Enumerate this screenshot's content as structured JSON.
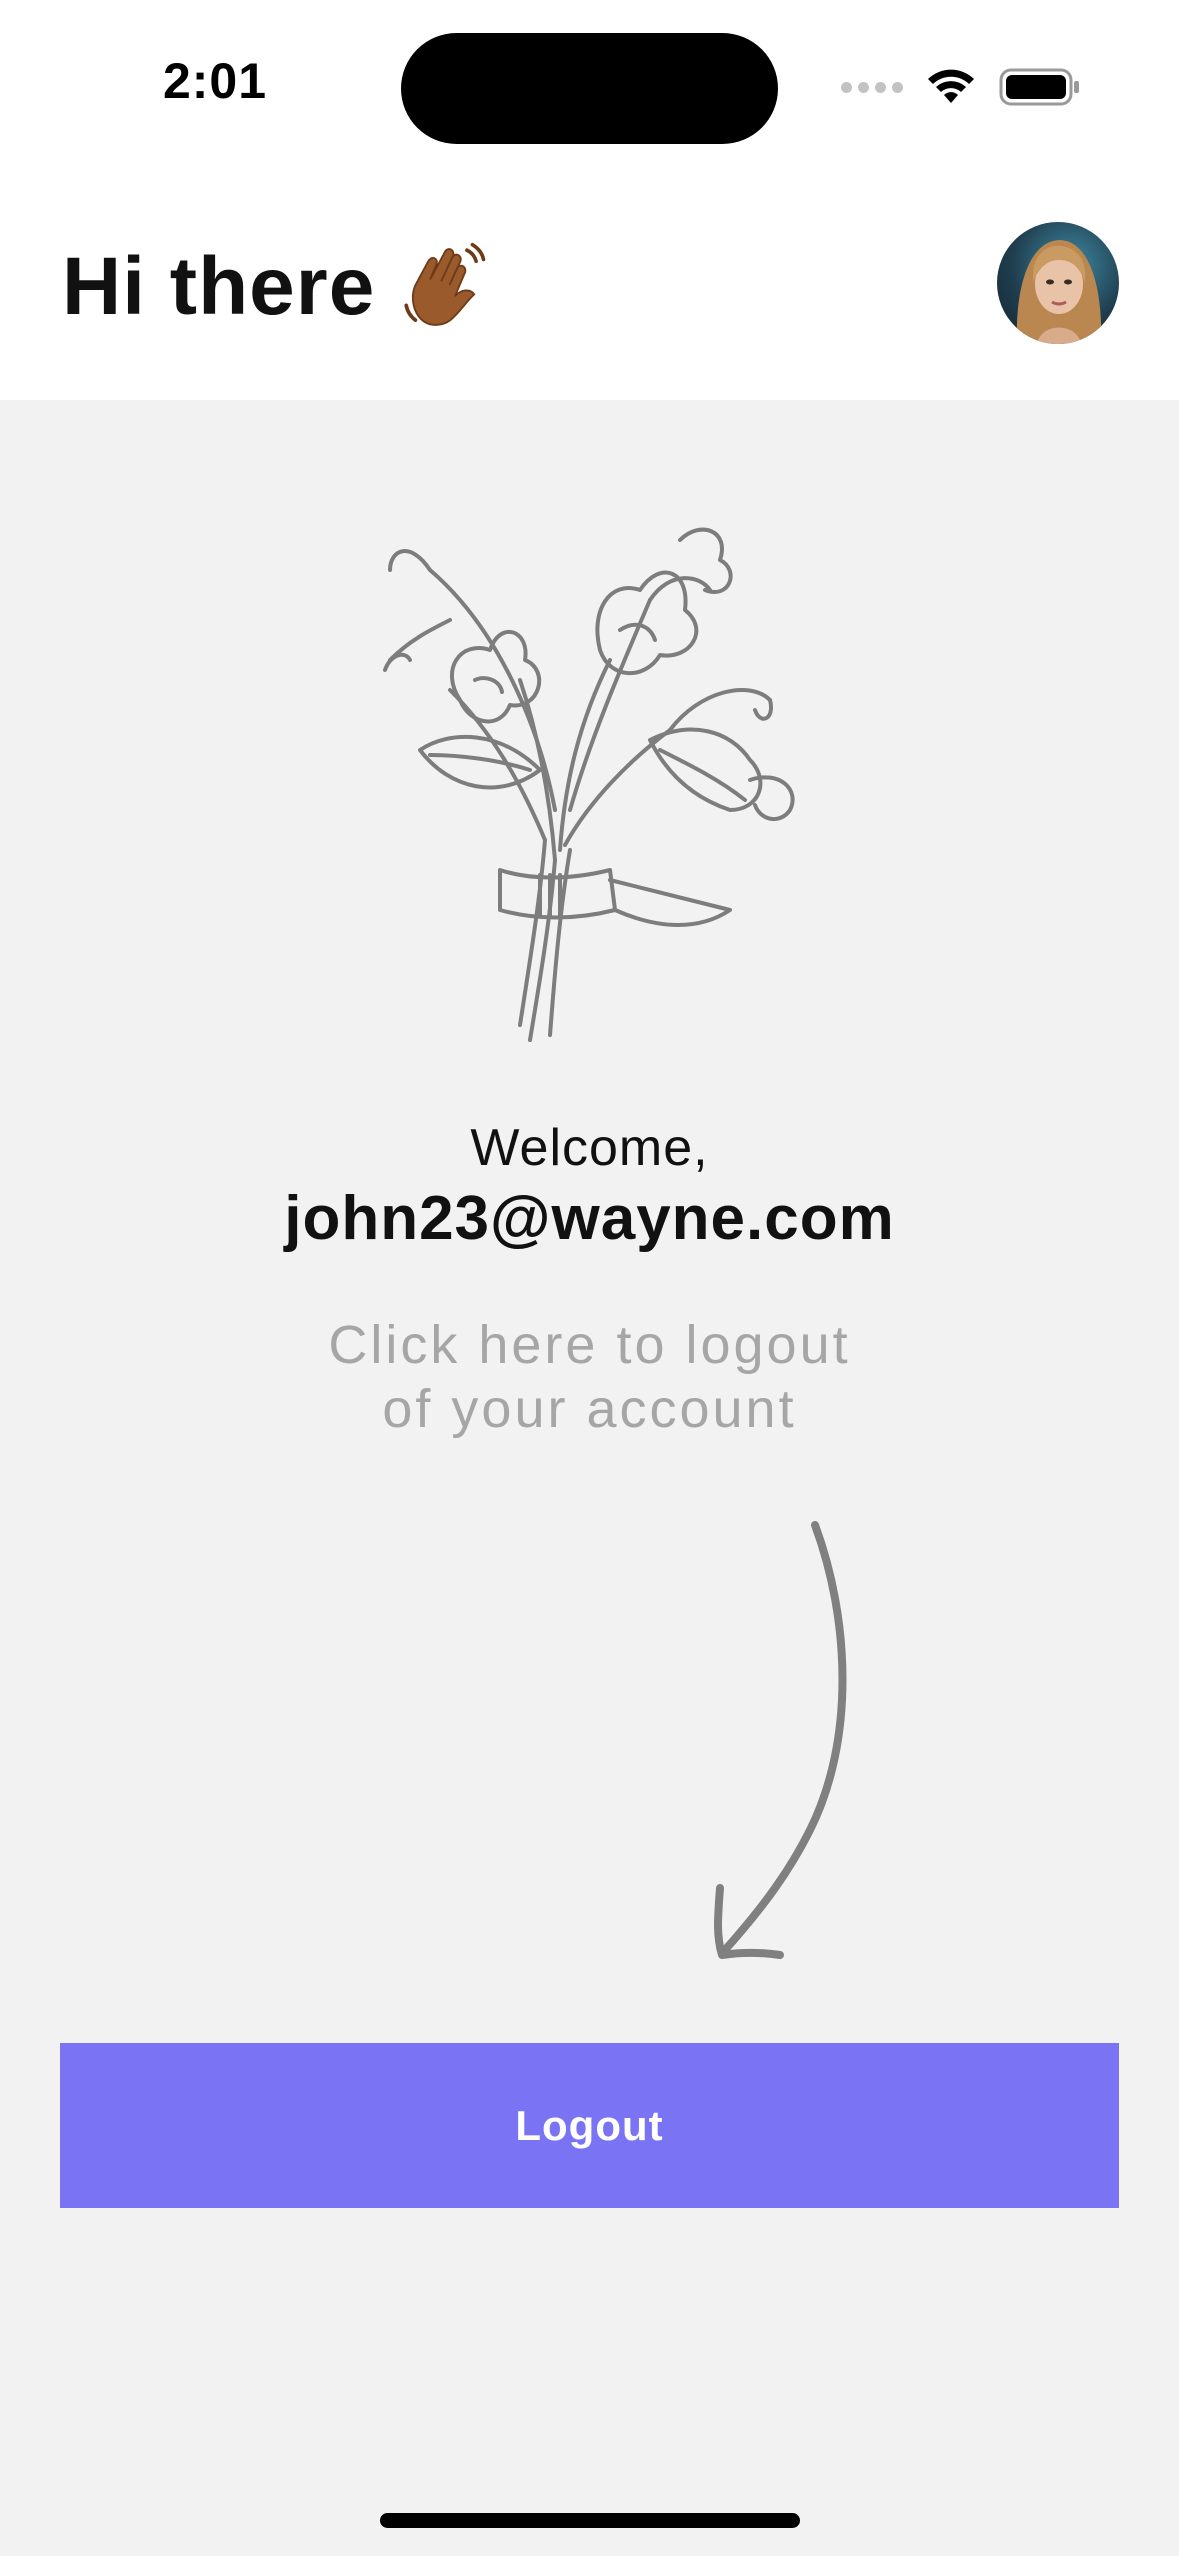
{
  "status_bar": {
    "time": "2:01",
    "icons": [
      "signal-icon",
      "wifi-icon",
      "battery-icon"
    ]
  },
  "header": {
    "greeting": "Hi there",
    "emoji": "wave-emoji",
    "avatar": "profile-avatar"
  },
  "main": {
    "illustration": "flower-bouquet-illustration",
    "welcome_label": "Welcome,",
    "email": "john23@wayne.com",
    "hint_line1": "Click here to logout",
    "hint_line2": "of your account",
    "arrow": "curved-arrow-icon"
  },
  "actions": {
    "logout_label": "Logout"
  },
  "colors": {
    "accent": "#7a74f4",
    "background": "#f2f2f2",
    "header_background": "#ffffff",
    "hint_text": "#a6a6a6"
  }
}
